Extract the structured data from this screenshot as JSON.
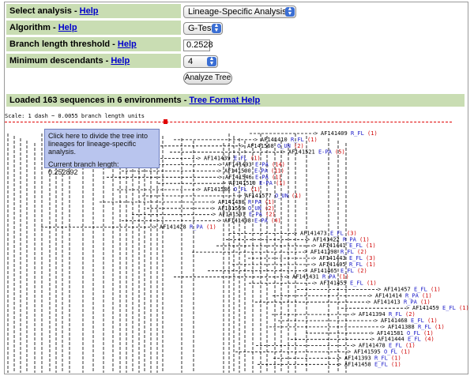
{
  "form": {
    "rows": [
      {
        "label": "Select analysis",
        "help": "Help",
        "control": "select",
        "value": "Lineage-Specific Analysis"
      },
      {
        "label": "Algorithm",
        "help": "Help",
        "control": "select",
        "value": "G-Test"
      },
      {
        "label": "Branch length threshold",
        "help": "Help",
        "control": "text",
        "value": "0.2528"
      },
      {
        "label": "Minimum descendants",
        "help": "Help",
        "control": "select",
        "value": "4"
      }
    ],
    "submit_label": "Analyze Tree"
  },
  "loaded": {
    "text": "Loaded 163 sequences in 6 environments - ",
    "link": "Tree Format Help"
  },
  "scale_text": "Scale: 1 dash ~ 0.0055 branch length units",
  "tooltip": {
    "line1": "Click here to divide the tree into",
    "line2": "lineages for lineage-specific analysis.",
    "line3": "Current branch length:",
    "value": "0.252892"
  },
  "colors": {
    "label_bg": "#c9ddb3",
    "link": "#0000cc",
    "env": "#1a1ac8",
    "count": "#d00000",
    "threshold_line": "#e00000"
  },
  "tree": {
    "leaves": [
      {
        "id": "AF141409",
        "env": "R_FL",
        "count": "(1)"
      },
      {
        "id": "AF141410",
        "env": "R_FL",
        "count": "(1)"
      },
      {
        "id": "AF141568",
        "env": "O_UN",
        "count": "(2)"
      },
      {
        "id": "AF141521",
        "env": "E-PA",
        "count": "(5)"
      },
      {
        "id": "AF141439",
        "env": "E_FL",
        "count": "(1)"
      },
      {
        "id": "AF141493",
        "env": "E-PA",
        "count": "(14)"
      },
      {
        "id": "AF141500",
        "env": "E-PA",
        "count": "(11)"
      },
      {
        "id": "AF141546",
        "env": "E-PA",
        "count": "(1)"
      },
      {
        "id": "AF141510",
        "env": "E-PA",
        "count": "(1)"
      },
      {
        "id": "AF141586",
        "env": "O_FL",
        "count": "(1)"
      },
      {
        "id": "AF141577",
        "env": "O_UN",
        "count": "(1)"
      },
      {
        "id": "AF141430",
        "env": "R_PA",
        "count": "(1)"
      },
      {
        "id": "AF141569",
        "env": "O_UN",
        "count": "(2)"
      },
      {
        "id": "AF141501",
        "env": "E-PA",
        "count": "(2)"
      },
      {
        "id": "AF141498",
        "env": "E-PA",
        "count": "(4)"
      },
      {
        "id": "AF141428",
        "env": "R_PA",
        "count": "(1)"
      },
      {
        "id": "AF141473",
        "env": "E_FL",
        "count": "(3)"
      },
      {
        "id": "AF141422",
        "env": "R_PA",
        "count": "(1)"
      },
      {
        "id": "AF141441",
        "env": "E_FL",
        "count": "(1)"
      },
      {
        "id": "AF141398",
        "env": "R_FL",
        "count": "(2)"
      },
      {
        "id": "AF141443",
        "env": "E_FL",
        "count": "(3)"
      },
      {
        "id": "AF141405",
        "env": "R_FL",
        "count": "(1)"
      },
      {
        "id": "AF141465",
        "env": "E_FL",
        "count": "(2)"
      },
      {
        "id": "AF141431",
        "env": "R_PA",
        "count": "(1)"
      },
      {
        "id": "AF141455",
        "env": "E_FL",
        "count": "(1)"
      },
      {
        "id": "AF141457",
        "env": "E_FL",
        "count": "(1)"
      },
      {
        "id": "AF141414",
        "env": "R_PA",
        "count": "(1)"
      },
      {
        "id": "AF141413",
        "env": "R_PA",
        "count": "(1)"
      },
      {
        "id": "AF141459",
        "env": "E_FL",
        "count": "(1)"
      },
      {
        "id": "AF141394",
        "env": "R_FL",
        "count": "(2)"
      },
      {
        "id": "AF141468",
        "env": "E_FL",
        "count": "(1)"
      },
      {
        "id": "AF141388",
        "env": "R_FL",
        "count": "(1)"
      },
      {
        "id": "AF141581",
        "env": "O_FL",
        "count": "(1)"
      },
      {
        "id": "AF141444",
        "env": "E_FL",
        "count": "(4)"
      },
      {
        "id": "AF141478",
        "env": "E_FL",
        "count": "(1)"
      },
      {
        "id": "AF141595",
        "env": "O_FL",
        "count": "(1)"
      },
      {
        "id": "AF141393",
        "env": "R_FL",
        "count": "(1)"
      },
      {
        "id": "AF141458",
        "env": "E_FL",
        "count": "(1)"
      }
    ]
  }
}
